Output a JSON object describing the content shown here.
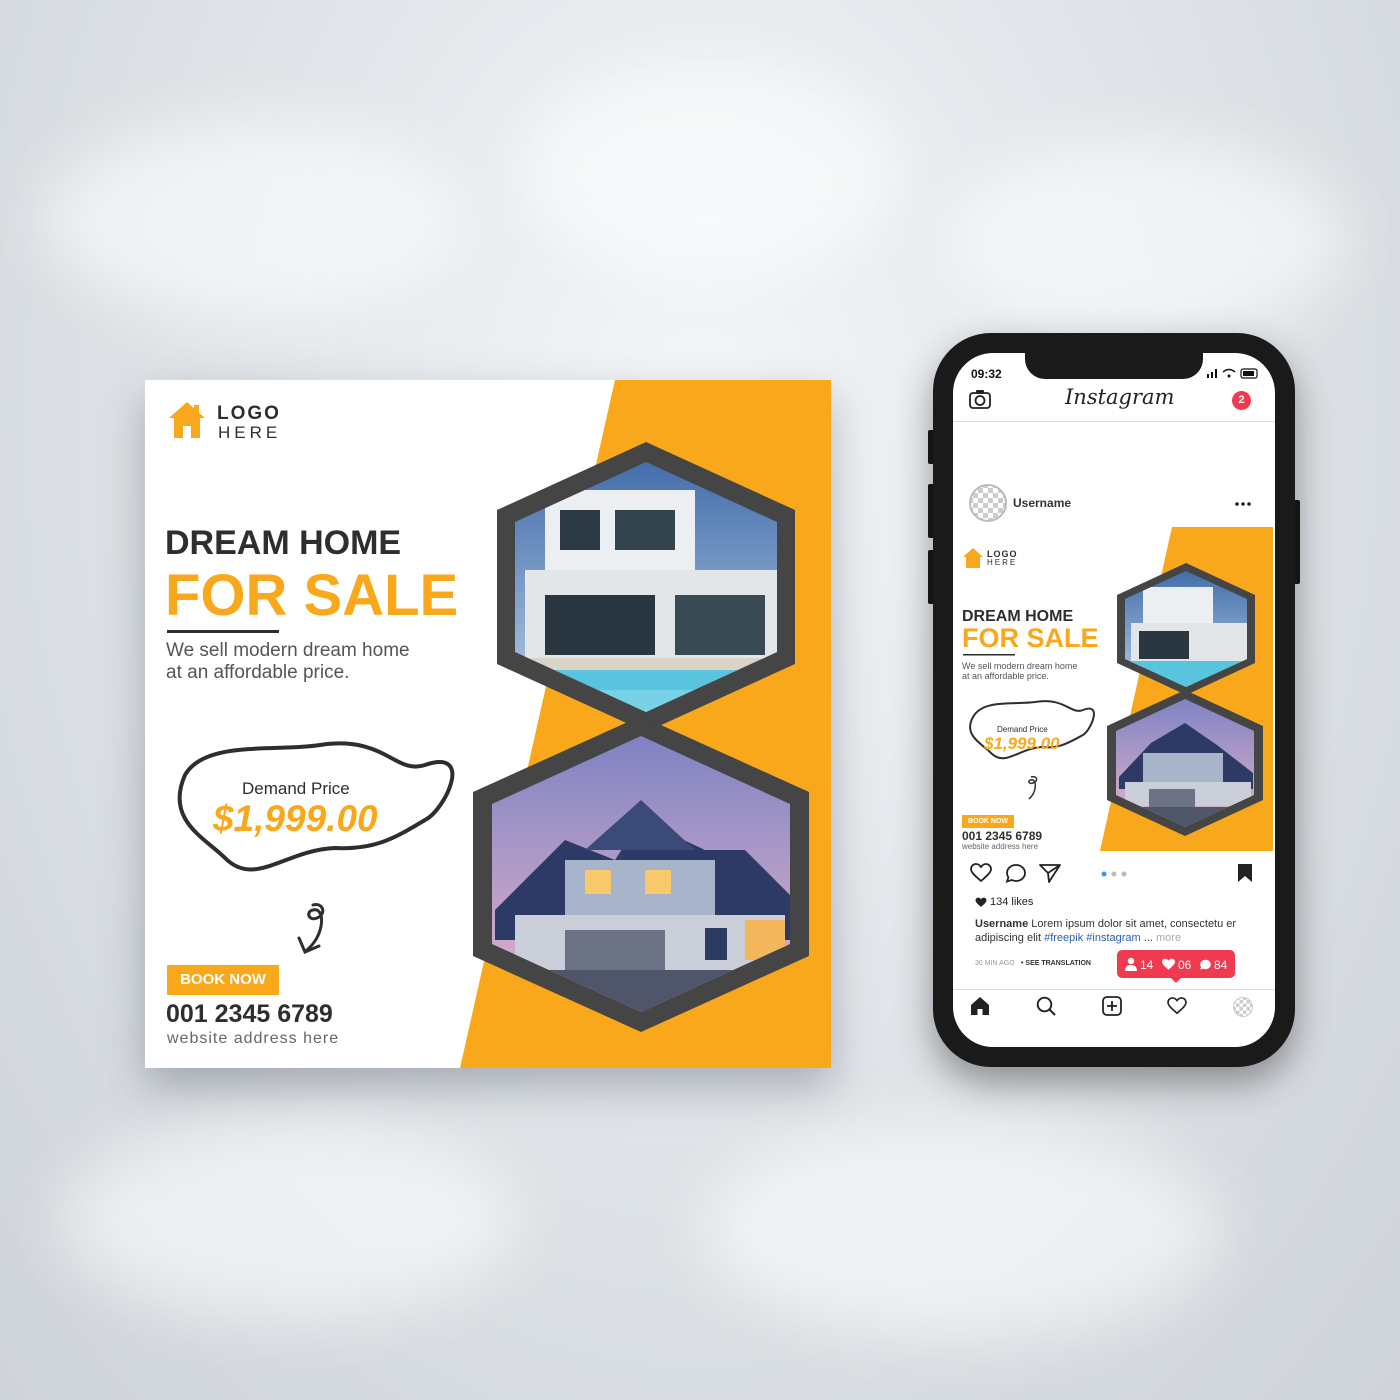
{
  "poster": {
    "logo_line1": "LOGO",
    "logo_line2": "HERE",
    "headline_1": "DREAM HOME",
    "headline_2": "FOR SALE",
    "subtitle_line1": "We sell modern dream home",
    "subtitle_line2": "at an affordable price.",
    "price_label": "Demand Price",
    "price_value": "$1,999.00",
    "cta_label": "BOOK NOW",
    "phone_number": "001 2345 6789",
    "website": "website address here"
  },
  "phone": {
    "status_time": "09:32",
    "app_name": "Instagram",
    "notification_count": "2",
    "username": "Username",
    "likes": "134 likes",
    "caption_user": "Username",
    "caption_text": " Lorem ipsum dolor sit amet, consectetu er adipiscing elit ",
    "hashtag_1": "#freepik",
    "hashtag_2": "#instagram",
    "caption_ellipsis": " ... ",
    "more_label": "more",
    "time_ago": "30 MIN AGO",
    "see_translation": "• SEE TRANSLATION",
    "activity_followers": "14",
    "activity_likes": "06",
    "activity_comments": "84"
  },
  "colors": {
    "accent": "#f9a81b",
    "dark": "#2e2e2e",
    "hex_frame": "#454545",
    "notification": "#ef3a4f"
  },
  "icons": [
    "house-logo-icon",
    "camera-icon",
    "more-icon",
    "heart-icon",
    "comment-icon",
    "send-icon",
    "bookmark-icon",
    "home-icon",
    "search-icon",
    "add-icon",
    "profile-icon",
    "person-icon",
    "arrow-icon"
  ]
}
